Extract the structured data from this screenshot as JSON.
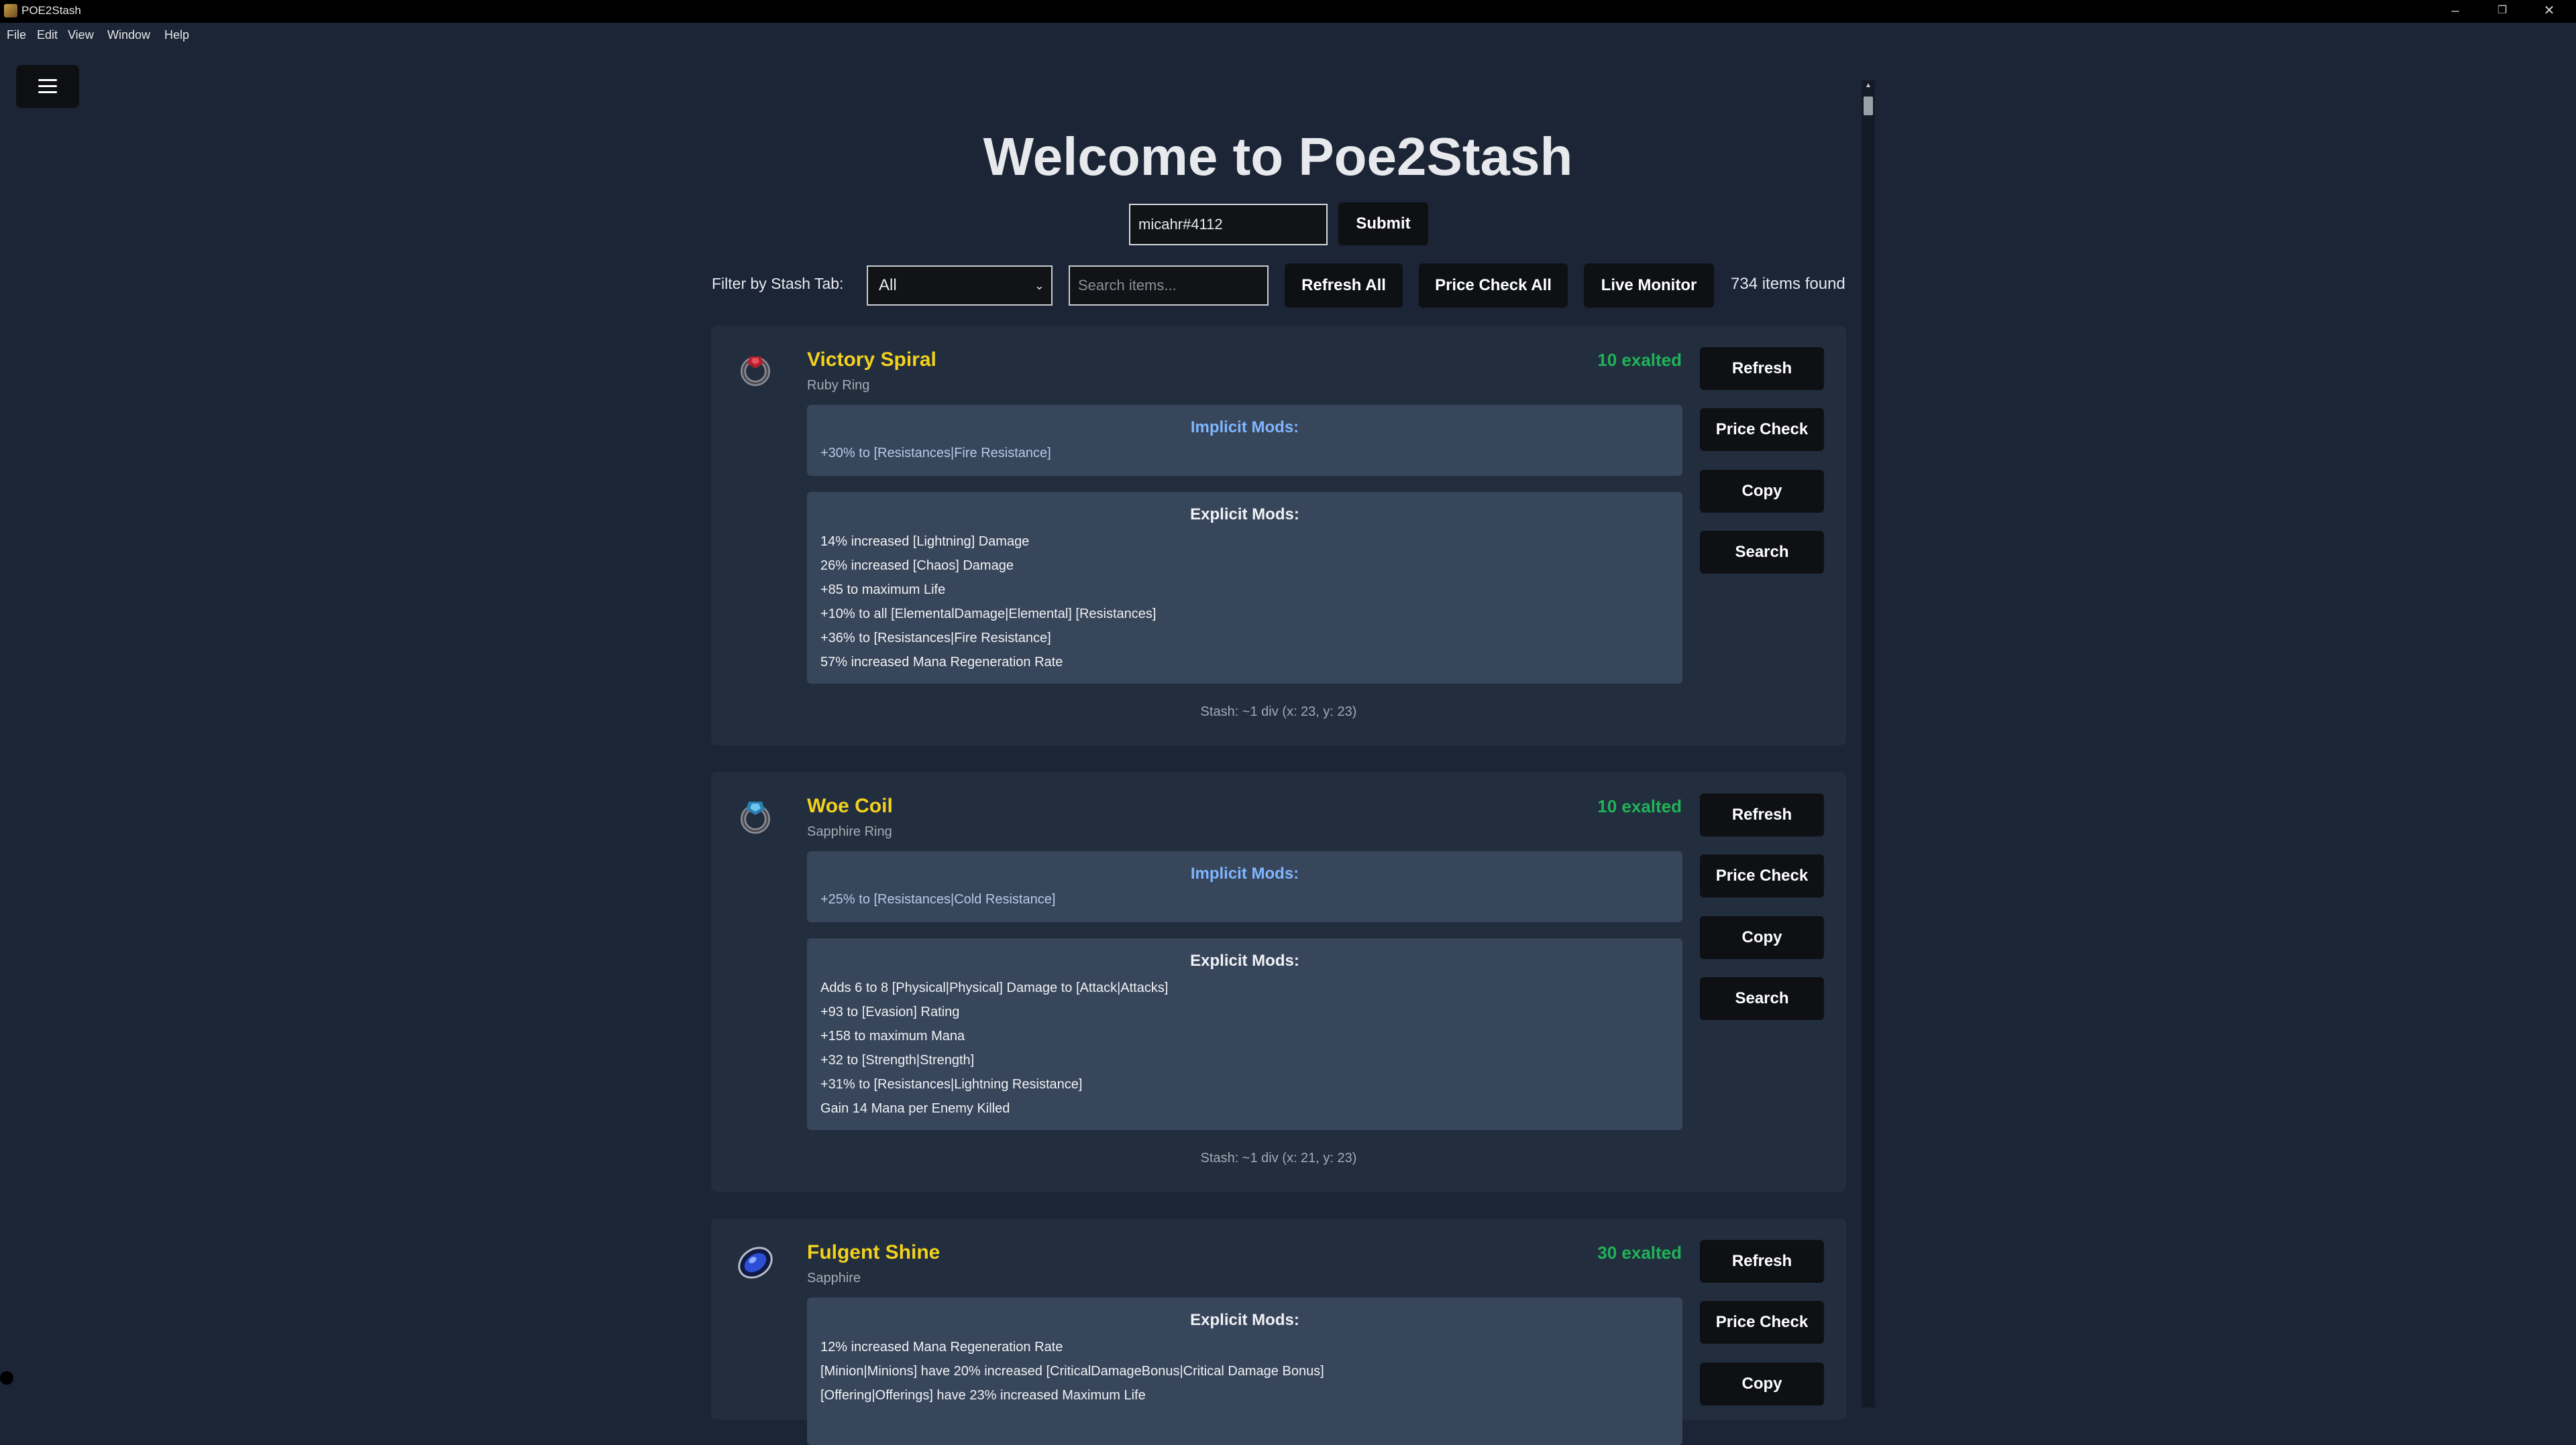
{
  "window": {
    "title": "POE2Stash",
    "minimize": "–",
    "restore": "❐",
    "close": "✕"
  },
  "menu": [
    "File",
    "Edit",
    "View",
    "Window",
    "Help"
  ],
  "header": {
    "welcome": "Welcome to Poe2Stash",
    "account_value": "micahr#4112",
    "submit_label": "Submit"
  },
  "toolbar": {
    "filter_label": "Filter by Stash Tab:",
    "filter_value": "All",
    "search_placeholder": "Search items...",
    "refresh_all_label": "Refresh All",
    "price_check_all_label": "Price Check All",
    "live_monitor_label": "Live Monitor",
    "items_found": "734 items found"
  },
  "item_buttons": {
    "refresh": "Refresh",
    "price_check": "Price Check",
    "copy": "Copy",
    "search": "Search"
  },
  "items": [
    {
      "name": "Victory Spiral",
      "type": "Ruby Ring",
      "price": "10 exalted",
      "icon": "ruby-ring-icon",
      "implicit_title": "Implicit Mods:",
      "implicit": [
        "+30% to [Resistances|Fire Resistance]"
      ],
      "explicit_title": "Explicit Mods:",
      "explicit": [
        "14% increased [Lightning] Damage",
        "26% increased [Chaos] Damage",
        "+85 to maximum Life",
        "+10% to all [ElementalDamage|Elemental] [Resistances]",
        "+36% to [Resistances|Fire Resistance]",
        "57% increased Mana Regeneration Rate"
      ],
      "stash": "Stash: ~1 div (x: 23, y: 23)"
    },
    {
      "name": "Woe Coil",
      "type": "Sapphire Ring",
      "price": "10 exalted",
      "icon": "sapphire-ring-icon",
      "implicit_title": "Implicit Mods:",
      "implicit": [
        "+25% to [Resistances|Cold Resistance]"
      ],
      "explicit_title": "Explicit Mods:",
      "explicit": [
        "Adds 6 to 8 [Physical|Physical] Damage to [Attack|Attacks]",
        "+93 to [Evasion] Rating",
        "+158 to maximum Mana",
        "+32 to [Strength|Strength]",
        "+31% to [Resistances|Lightning Resistance]",
        "Gain 14 Mana per Enemy Killed"
      ],
      "stash": "Stash: ~1 div (x: 21, y: 23)"
    },
    {
      "name": "Fulgent Shine",
      "type": "Sapphire",
      "price": "30 exalted",
      "icon": "sapphire-jewel-icon",
      "explicit_title": "Explicit Mods:",
      "explicit": [
        "12% increased Mana Regeneration Rate",
        "[Minion|Minions] have 20% increased [CriticalDamageBonus|Critical Damage Bonus]",
        "[Offering|Offerings] have 23% increased Maximum Life"
      ]
    }
  ],
  "colors": {
    "background": "#1b2536",
    "card": "#222d3e",
    "mod_box": "#38465b",
    "item_name": "#f2d21c",
    "price": "#1fb457",
    "implicit_title": "#7fb6ff"
  }
}
